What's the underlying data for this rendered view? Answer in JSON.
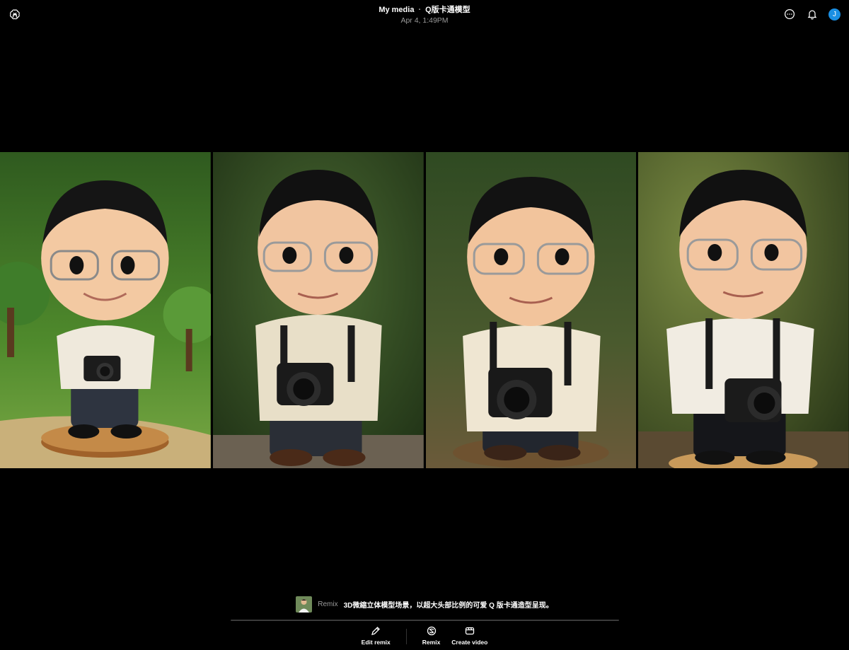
{
  "header": {
    "breadcrumb_root": "My media",
    "breadcrumb_separator": "·",
    "title": "Q版卡通模型",
    "timestamp": "Apr 4, 1:49PM",
    "avatar_initial": "J",
    "icons": {
      "logo": "openai-logo-icon",
      "more": "more-options-icon",
      "notifications": "bell-icon"
    }
  },
  "gallery": {
    "images": [
      {
        "name": "chibi-figure-1",
        "background": "cartoon-forest",
        "accent": "#5a9a3a"
      },
      {
        "name": "chibi-figure-2",
        "background": "blurred-forest",
        "accent": "#3f5a2c"
      },
      {
        "name": "chibi-figure-3",
        "background": "forest-path",
        "accent": "#4a5a2a"
      },
      {
        "name": "chibi-figure-4",
        "background": "sunlit-forest",
        "accent": "#6a7a3a"
      }
    ]
  },
  "prompt": {
    "remix_label": "Remix",
    "text": "3D微縮立体模型场景，以超大头部比例的可爱 Q 版卡通造型呈现。"
  },
  "actions": {
    "edit_remix": "Edit remix",
    "remix": "Remix",
    "create_video": "Create video"
  },
  "colors": {
    "background": "#000000",
    "avatar": "#1a8fe3",
    "muted_text": "#9a9a9a"
  }
}
